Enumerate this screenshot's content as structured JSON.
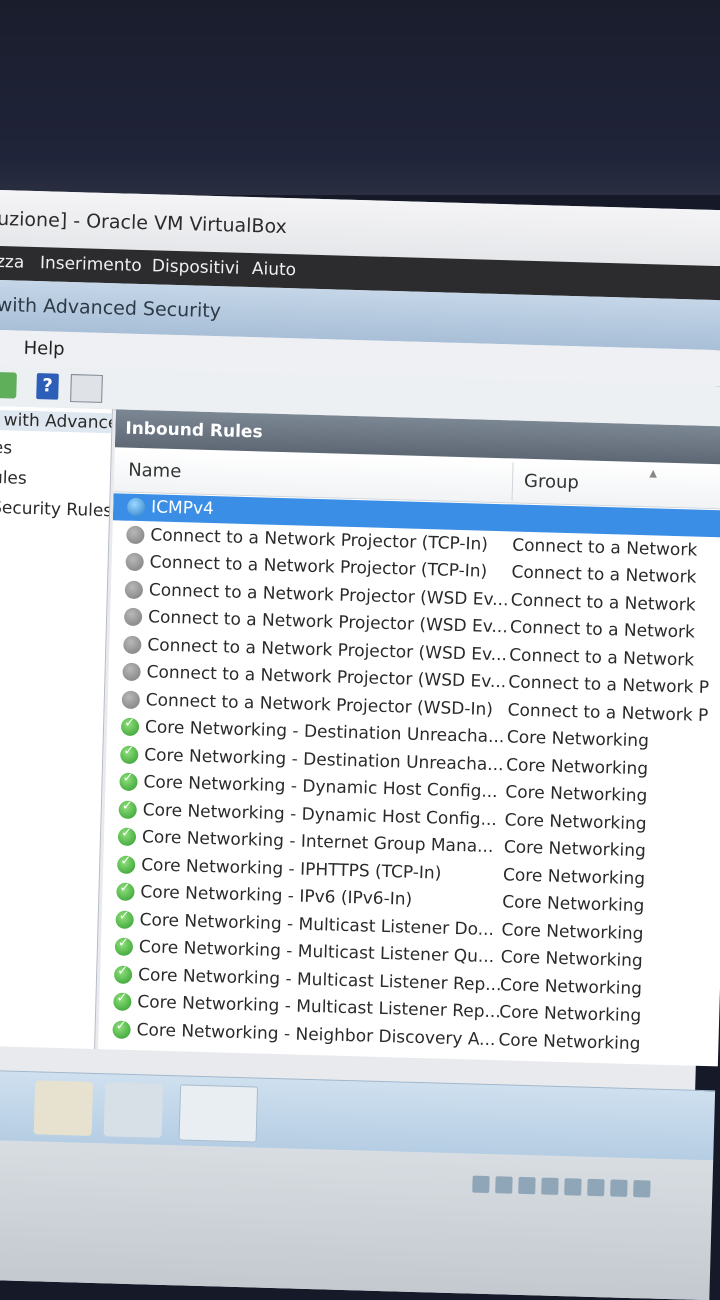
{
  "window": {
    "title": "uzione] - Oracle VM VirtualBox"
  },
  "vbox_menu": [
    "zza",
    "Inserimento",
    "Dispositivi",
    "Aiuto"
  ],
  "mmc": {
    "title": "with Advanced Security",
    "menu_help": "Help"
  },
  "tree": {
    "items": [
      "l with Advance",
      "es",
      "ules",
      "Security Rules"
    ]
  },
  "panel": {
    "title": "Inbound Rules",
    "columns": {
      "name": "Name",
      "group": "Group"
    }
  },
  "rules": [
    {
      "name": "ICMPv4",
      "group": "",
      "icon": "blue",
      "selected": true
    },
    {
      "name": "Connect to a Network Projector (TCP-In)",
      "group": "Connect to a Network",
      "icon": "gray"
    },
    {
      "name": "Connect to a Network Projector (TCP-In)",
      "group": "Connect to a Network",
      "icon": "gray"
    },
    {
      "name": "Connect to a Network Projector (WSD Ev...",
      "group": "Connect to a Network",
      "icon": "gray"
    },
    {
      "name": "Connect to a Network Projector (WSD Ev...",
      "group": "Connect to a Network",
      "icon": "gray"
    },
    {
      "name": "Connect to a Network Projector (WSD Ev...",
      "group": "Connect to a Network",
      "icon": "gray"
    },
    {
      "name": "Connect to a Network Projector (WSD Ev...",
      "group": "Connect to a Network P",
      "icon": "gray"
    },
    {
      "name": "Connect to a Network Projector (WSD-In)",
      "group": "Connect to a Network P",
      "icon": "gray"
    },
    {
      "name": "Core Networking - Destination Unreacha...",
      "group": "Core Networking",
      "icon": "green"
    },
    {
      "name": "Core Networking - Destination Unreacha...",
      "group": "Core Networking",
      "icon": "green"
    },
    {
      "name": "Core Networking - Dynamic Host Config...",
      "group": "Core Networking",
      "icon": "green"
    },
    {
      "name": "Core Networking - Dynamic Host Config...",
      "group": "Core Networking",
      "icon": "green"
    },
    {
      "name": "Core Networking - Internet Group Mana...",
      "group": "Core Networking",
      "icon": "green"
    },
    {
      "name": "Core Networking - IPHTTPS (TCP-In)",
      "group": "Core Networking",
      "icon": "green"
    },
    {
      "name": "Core Networking - IPv6 (IPv6-In)",
      "group": "Core Networking",
      "icon": "green"
    },
    {
      "name": "Core Networking - Multicast Listener Do...",
      "group": "Core Networking",
      "icon": "green"
    },
    {
      "name": "Core Networking - Multicast Listener Qu...",
      "group": "Core Networking",
      "icon": "green"
    },
    {
      "name": "Core Networking - Multicast Listener Rep...",
      "group": "Core Networking",
      "icon": "green"
    },
    {
      "name": "Core Networking - Multicast Listener Rep...",
      "group": "Core Networking",
      "icon": "green"
    },
    {
      "name": "Core Networking - Neighbor Discovery A...",
      "group": "Core Networking",
      "icon": "green"
    }
  ],
  "colors": {
    "selection": "#3a8ee6",
    "panel_header": "#5e6874",
    "enabled_rule": "#2e9a2e",
    "disabled_rule": "#7a7a7a"
  }
}
